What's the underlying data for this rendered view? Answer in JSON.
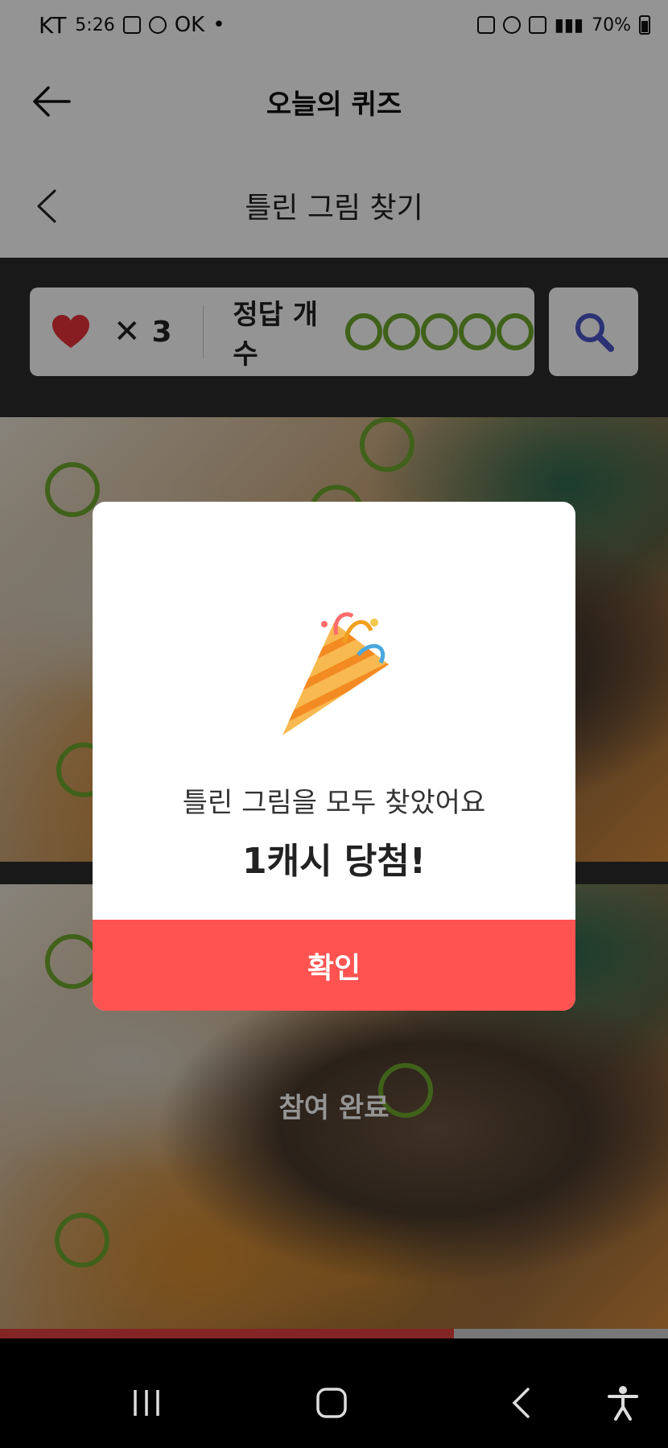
{
  "status_bar": {
    "carrier": "KT",
    "time": "5:26",
    "extra": "OK",
    "battery": "70%"
  },
  "header": {
    "title": "오늘의 퀴즈"
  },
  "sub_header": {
    "title": "틀린 그림 찾기"
  },
  "game_status": {
    "lives_symbol": "✕",
    "lives_count": "3",
    "answers_label": "정답 개수",
    "answers_found": 5,
    "answers_total": 5
  },
  "photo": {
    "done_label": "참여 완료",
    "progress": 0.68
  },
  "modal": {
    "message": "틀린 그림을 모두 찾았어요",
    "prize": "1캐시 당첨!",
    "confirm_label": "확인"
  },
  "icons": [
    "back-arrow-icon",
    "chevron-left-icon",
    "heart-icon",
    "search-icon",
    "confetti-icon",
    "recent-apps-icon",
    "home-icon",
    "back-icon",
    "accessibility-icon"
  ],
  "colors": {
    "accent": "#ff5352",
    "found": "#6fa82e",
    "heart": "#e8333a"
  }
}
